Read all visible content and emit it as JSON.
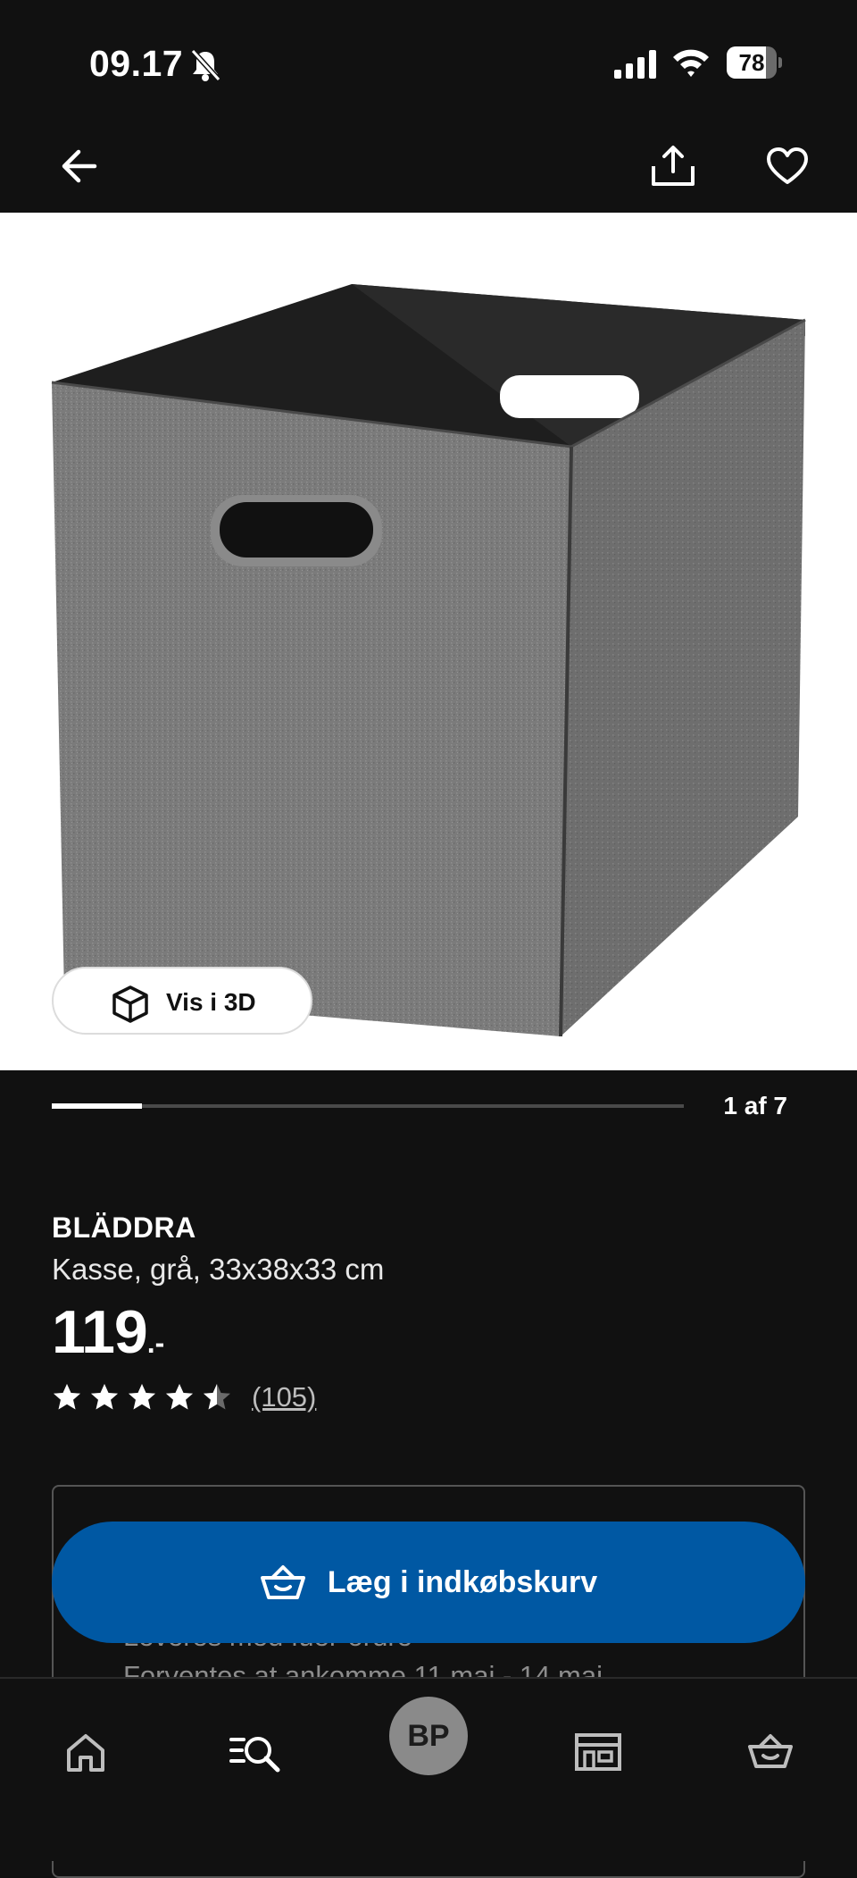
{
  "status_bar": {
    "time": "09.17",
    "battery_level": "78",
    "battery_fraction": 0.78
  },
  "nav": {
    "back_icon": "arrow-left-icon",
    "share_icon": "share-icon",
    "favorite_icon": "heart-outline-icon"
  },
  "gallery": {
    "view_3d_label": "Vis i 3D",
    "counter": "1 af 7",
    "current": 1,
    "total": 7
  },
  "product": {
    "name": "BLÄDDRA",
    "description": "Kasse, grå, 33x38x33 cm",
    "price": "119",
    "price_suffix": ".-",
    "rating": 4.5,
    "review_count": "(105)"
  },
  "delivery": {
    "line1": "Leveres med fuer-ordre",
    "line2": "Forventes at ankomme 11 maj - 14 maj"
  },
  "cta": {
    "add_to_cart_label": "Læg i indkøbskurv"
  },
  "bottom_nav": {
    "profile_initials": "BP",
    "tabs": [
      "home-icon",
      "search-list-icon",
      "profile-avatar",
      "store-icon",
      "basket-icon"
    ]
  },
  "colors": {
    "background": "#111111",
    "accent_blue": "#0058a3",
    "product_gray": "#7a7a7a"
  }
}
